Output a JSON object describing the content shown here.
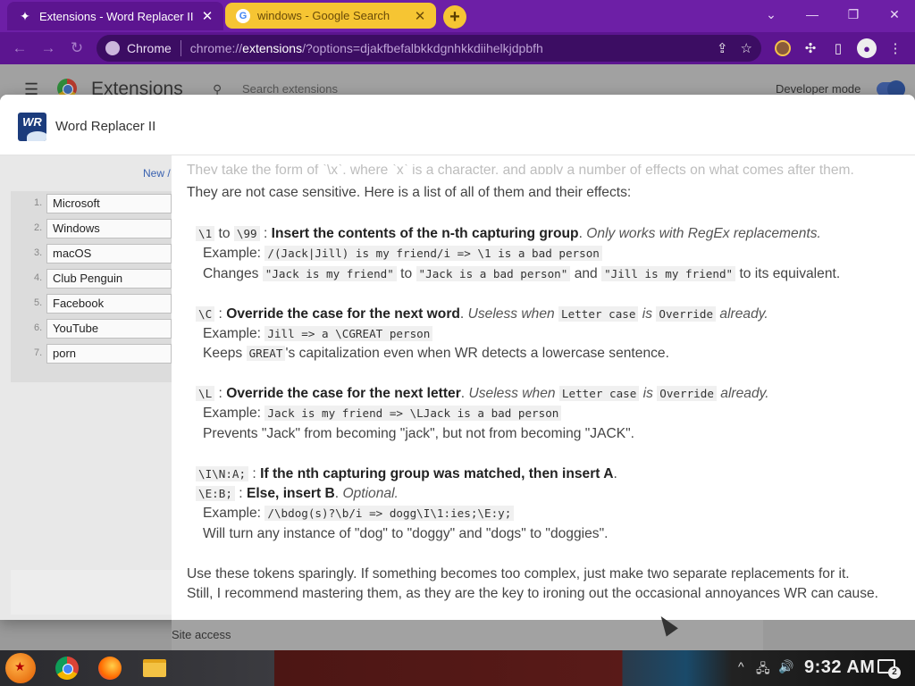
{
  "tabs": [
    {
      "title": "Extensions - Word Replacer II",
      "icon": "puzzle-icon",
      "active": true
    },
    {
      "title": "windows - Google Search",
      "icon": "google-icon",
      "active": false
    }
  ],
  "toolbar": {
    "site_label": "Chrome",
    "url_scheme": "chrome://",
    "url_host": "extensions",
    "url_rest": "/?options=djakfbefalbkkdgnhkkdiihelkjdpbfh"
  },
  "extensions_page": {
    "title": "Extensions",
    "search_placeholder": "Search extensions",
    "developer_mode_label": "Developer mode",
    "site_access_label": "Site access"
  },
  "dialog": {
    "icon_text": "WR",
    "title": "Word Replacer II",
    "new_link": "New /",
    "replacements": [
      {
        "n": "1.",
        "text": "Microsoft"
      },
      {
        "n": "2.",
        "text": "Windows"
      },
      {
        "n": "3.",
        "text": "macOS"
      },
      {
        "n": "4.",
        "text": "Club Penguin"
      },
      {
        "n": "5.",
        "text": "Facebook"
      },
      {
        "n": "6.",
        "text": "YouTube"
      },
      {
        "n": "7.",
        "text": "porn"
      }
    ]
  },
  "help": {
    "cut_line": "They take the form of `\\x`, where `x` is a character, and apply a number of effects on what comes after them.",
    "intro": "They are not case sensitive. Here is a list of all of them and their effects:",
    "t1": {
      "code_a": "\\1",
      "to": "to",
      "code_b": "\\99",
      "sep": ":",
      "bold": "Insert the contents of the n-th capturing group",
      "dot": ".",
      "italic": "Only works with RegEx replacements.",
      "ex_label": "Example:",
      "ex_code": "/(Jack|Jill) is my friend/i => \\1 is a bad person",
      "desc_a": "Changes",
      "desc_code1": "\"Jack is my friend\"",
      "desc_to": "to",
      "desc_code2": "\"Jack is a bad person\"",
      "desc_and": "and",
      "desc_code3": "\"Jill is my friend\"",
      "desc_end": "to its equivalent."
    },
    "t2": {
      "code": "\\C",
      "sep": ":",
      "bold": "Override the case for the next word",
      "dot": ".",
      "italic_a": "Useless when",
      "code_a": "Letter case",
      "italic_b": "is",
      "code_b": "Override",
      "italic_c": "already.",
      "ex_label": "Example:",
      "ex_code": "Jill => a \\CGREAT person",
      "desc_a": "Keeps",
      "desc_code": "GREAT",
      "desc_b": "'s capitalization even when WR detects a lowercase sentence."
    },
    "t3": {
      "code": "\\L",
      "sep": ":",
      "bold": "Override the case for the next letter",
      "dot": ".",
      "italic_a": "Useless when",
      "code_a": "Letter case",
      "italic_b": "is",
      "code_b": "Override",
      "italic_c": "already.",
      "ex_label": "Example:",
      "ex_code": "Jack is my friend => \\LJack is a bad person",
      "desc": "Prevents \"Jack\" from becoming \"jack\", but not from becoming \"JACK\"."
    },
    "t4": {
      "code_a": "\\I\\N:A;",
      "sep_a": ":",
      "bold_a": "If the nth capturing group was matched, then insert A",
      "dot_a": ".",
      "code_b": "\\E:B;",
      "sep_b": ":",
      "bold_b": "Else, insert B",
      "dot_b": ".",
      "italic": "Optional.",
      "ex_label": "Example:",
      "ex_code": "/\\bdog(s)?\\b/i => dogg\\I\\1:ies;\\E:y;",
      "desc": "Will turn any instance of \"dog\" to \"doggy\" and \"dogs\" to \"doggies\"."
    },
    "outro_1": "Use these tokens sparingly. If something becomes too complex, just make two separate replacements for it.",
    "outro_2": "Still, I recommend mastering them, as they are the key to ironing out the occasional annoyances WR can cause."
  },
  "taskbar": {
    "clock": "9:32 AM",
    "notification_count": "2"
  },
  "colors": {
    "tab_strip": "#6d1fa6",
    "toolbar": "#5c1590",
    "inactive_tab": "#f6c533"
  }
}
